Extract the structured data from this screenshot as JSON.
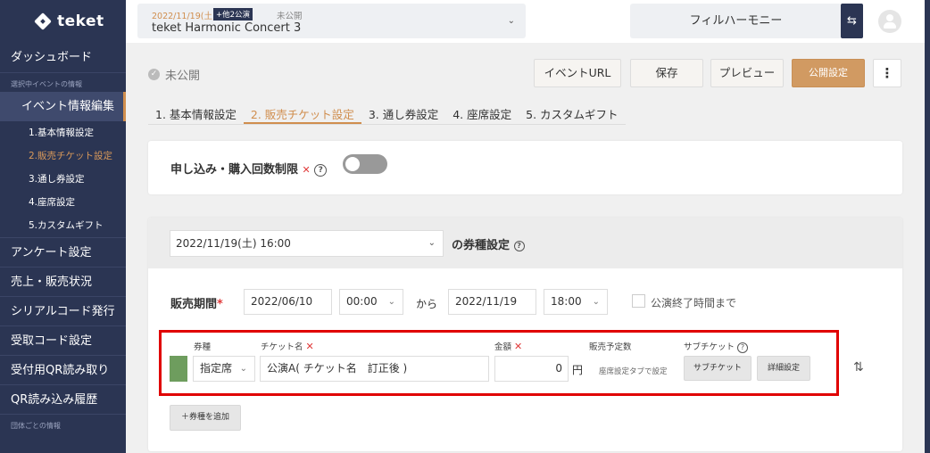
{
  "sidebar": {
    "logo": "teket",
    "dashboard": "ダッシュボード",
    "section_event": "選択中イベントの情報",
    "event_edit": "イベント情報編集",
    "sub_items": [
      "1.基本情報設定",
      "2.販売チケット設定",
      "3.通し券設定",
      "4.座席設定",
      "5.カスタムギフト"
    ],
    "items": [
      "アンケート設定",
      "売上・販売状況",
      "シリアルコード発行",
      "受取コード設定",
      "受付用QR読み取り",
      "QR読み込み履歴"
    ],
    "section_group": "団体ごとの情報"
  },
  "topbar": {
    "event_date": "2022/11/19(土)",
    "event_badge": "+他2公演",
    "event_status": "未公開",
    "event_name": "teket Harmonic Concert 3",
    "org_name": "フィルハーモニー"
  },
  "header": {
    "status": "未公開",
    "buttons": {
      "event_url": "イベントURL",
      "save": "保存",
      "preview": "プレビュー",
      "publish": "公開設定"
    }
  },
  "tabs": [
    "1. 基本情報設定",
    "2. 販売チケット設定",
    "3. 通し券設定",
    "4. 座席設定",
    "5. カスタムギフト"
  ],
  "limit_card": {
    "label": "申し込み・購入回数制限",
    "toggle_on": false
  },
  "ticket_card": {
    "date_select": "2022/11/19(土) 16:00",
    "title": "の券種設定",
    "period_label": "販売期間",
    "start_date": "2022/06/10",
    "start_time": "00:00",
    "from": "から",
    "end_date": "2022/11/19",
    "end_time": "18:00",
    "until_end_label": "公演終了時間まで",
    "columns": {
      "type": "券種",
      "name": "チケット名",
      "price": "金額",
      "planned": "販売予定数",
      "sub": "サブチケット"
    },
    "row": {
      "color": "#6e9d5e",
      "type": "指定席",
      "name": "公演A( チケット名　訂正後 )",
      "price": "0",
      "yen": "円",
      "planned_note": "座席設定タブで設定",
      "sub_button": "サブチケット",
      "detail_button": "詳細設定"
    },
    "add_button": "＋券種を追加"
  }
}
